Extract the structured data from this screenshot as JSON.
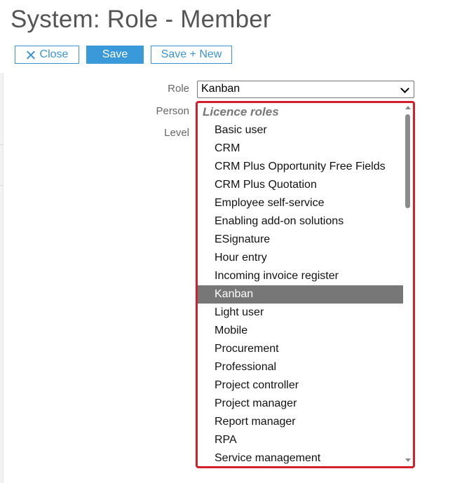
{
  "page": {
    "title": "System: Role - Member"
  },
  "toolbar": {
    "close_label": "Close",
    "save_label": "Save",
    "save_new_label": "Save + New"
  },
  "form": {
    "role_label": "Role",
    "person_label": "Person",
    "level_label": "Level",
    "role_value": "Kanban"
  },
  "dropdown": {
    "group_label": "Licence roles",
    "selected": "Kanban",
    "options": [
      "Basic user",
      "CRM",
      "CRM Plus Opportunity Free Fields",
      "CRM Plus Quotation",
      "Employee self-service",
      "Enabling add-on solutions",
      "ESignature",
      "Hour entry",
      "Incoming invoice register",
      "Kanban",
      "Light user",
      "Mobile",
      "Procurement",
      "Professional",
      "Project controller",
      "Project manager",
      "Report manager",
      "RPA",
      "Service management"
    ]
  },
  "colors": {
    "accent": "#3a9ad9",
    "highlight_border": "#d11f2b",
    "selected_bg": "#777777"
  }
}
